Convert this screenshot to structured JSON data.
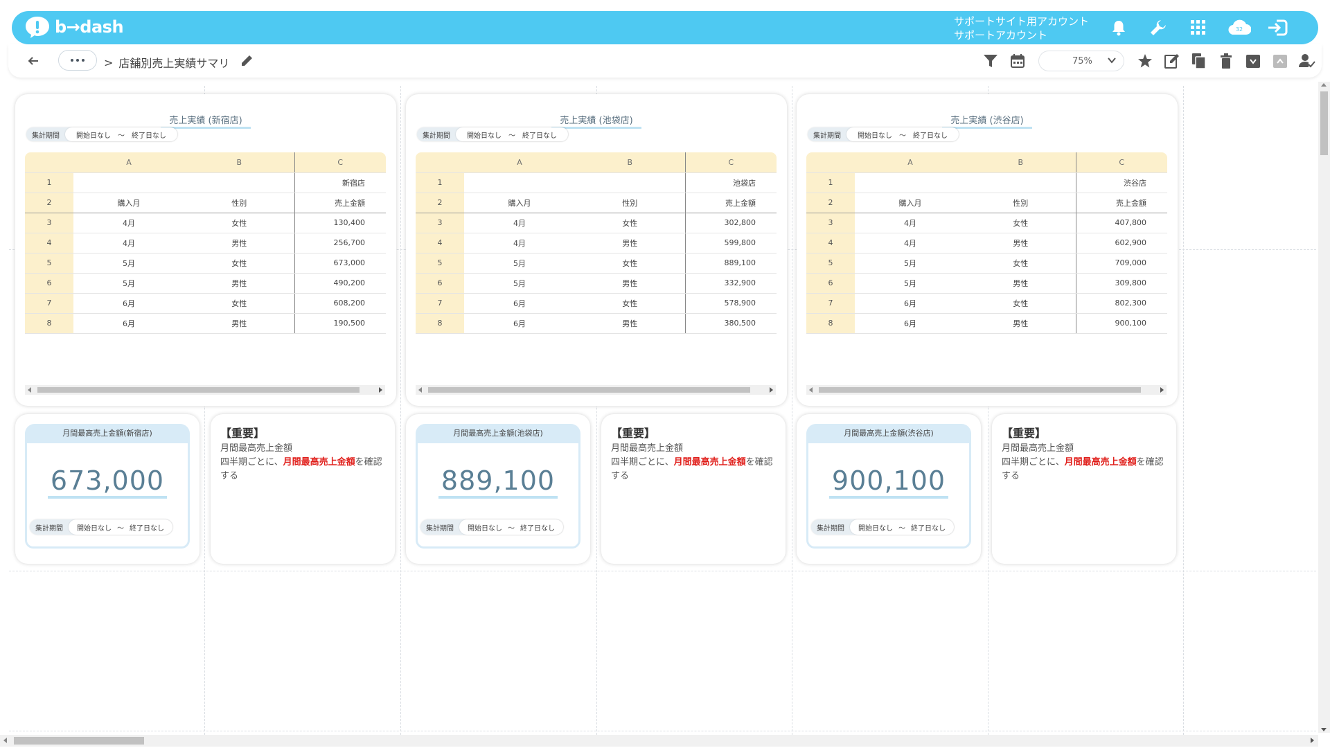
{
  "app": {
    "logo_text": "b→dash",
    "account_line1": "サポートサイト用アカウント",
    "account_line2": "サポートアカウント"
  },
  "header_icons": [
    "bell-icon",
    "wrench-icon",
    "apps-grid-icon",
    "cloud-icon",
    "logout-icon"
  ],
  "cloud_badge": "32",
  "breadcrumb": {
    "separator": ">",
    "current": "店舗別売上実績サマリ",
    "more": "•••"
  },
  "toolbar": {
    "zoom": "75%"
  },
  "period": {
    "label": "集計期間",
    "start": "開始日なし",
    "tilde": "〜",
    "end": "終了日なし"
  },
  "sheet_columns": [
    "A",
    "B",
    "C"
  ],
  "stores": [
    {
      "title": "売上実績 (新宿店)",
      "store": "新宿店",
      "rows": [
        [
          "購入月",
          "性別",
          "売上金額"
        ],
        [
          "4月",
          "女性",
          "130,400"
        ],
        [
          "4月",
          "男性",
          "256,700"
        ],
        [
          "5月",
          "女性",
          "673,000"
        ],
        [
          "5月",
          "男性",
          "490,200"
        ],
        [
          "6月",
          "女性",
          "608,200"
        ],
        [
          "6月",
          "男性",
          "190,500"
        ]
      ],
      "kpi_title": "月間最高売上金額(新宿店)",
      "kpi_value": "673,000"
    },
    {
      "title": "売上実績 (池袋店)",
      "store": "池袋店",
      "rows": [
        [
          "購入月",
          "性別",
          "売上金額"
        ],
        [
          "4月",
          "女性",
          "302,800"
        ],
        [
          "4月",
          "男性",
          "599,800"
        ],
        [
          "5月",
          "女性",
          "889,100"
        ],
        [
          "5月",
          "男性",
          "332,900"
        ],
        [
          "6月",
          "女性",
          "578,900"
        ],
        [
          "6月",
          "男性",
          "380,500"
        ]
      ],
      "kpi_title": "月間最高売上金額(池袋店)",
      "kpi_value": "889,100"
    },
    {
      "title": "売上実績 (渋谷店)",
      "store": "渋谷店",
      "rows": [
        [
          "購入月",
          "性別",
          "売上金額"
        ],
        [
          "4月",
          "女性",
          "407,800"
        ],
        [
          "4月",
          "男性",
          "602,900"
        ],
        [
          "5月",
          "女性",
          "709,000"
        ],
        [
          "5月",
          "男性",
          "309,800"
        ],
        [
          "6月",
          "女性",
          "802,300"
        ],
        [
          "6月",
          "男性",
          "900,100"
        ]
      ],
      "kpi_title": "月間最高売上金額(渋谷店)",
      "kpi_value": "900,100"
    }
  ],
  "note": {
    "title": "【重要】",
    "line1": "月間最高売上金額",
    "prefix": "四半期ごとに、",
    "highlight": "月間最高売上金額",
    "suffix": "を確認する"
  },
  "colors": {
    "header": "#4ec9f2",
    "sheet_header": "#fcf0cc",
    "kpi": "#5a7f95",
    "highlight": "#e0201c"
  }
}
